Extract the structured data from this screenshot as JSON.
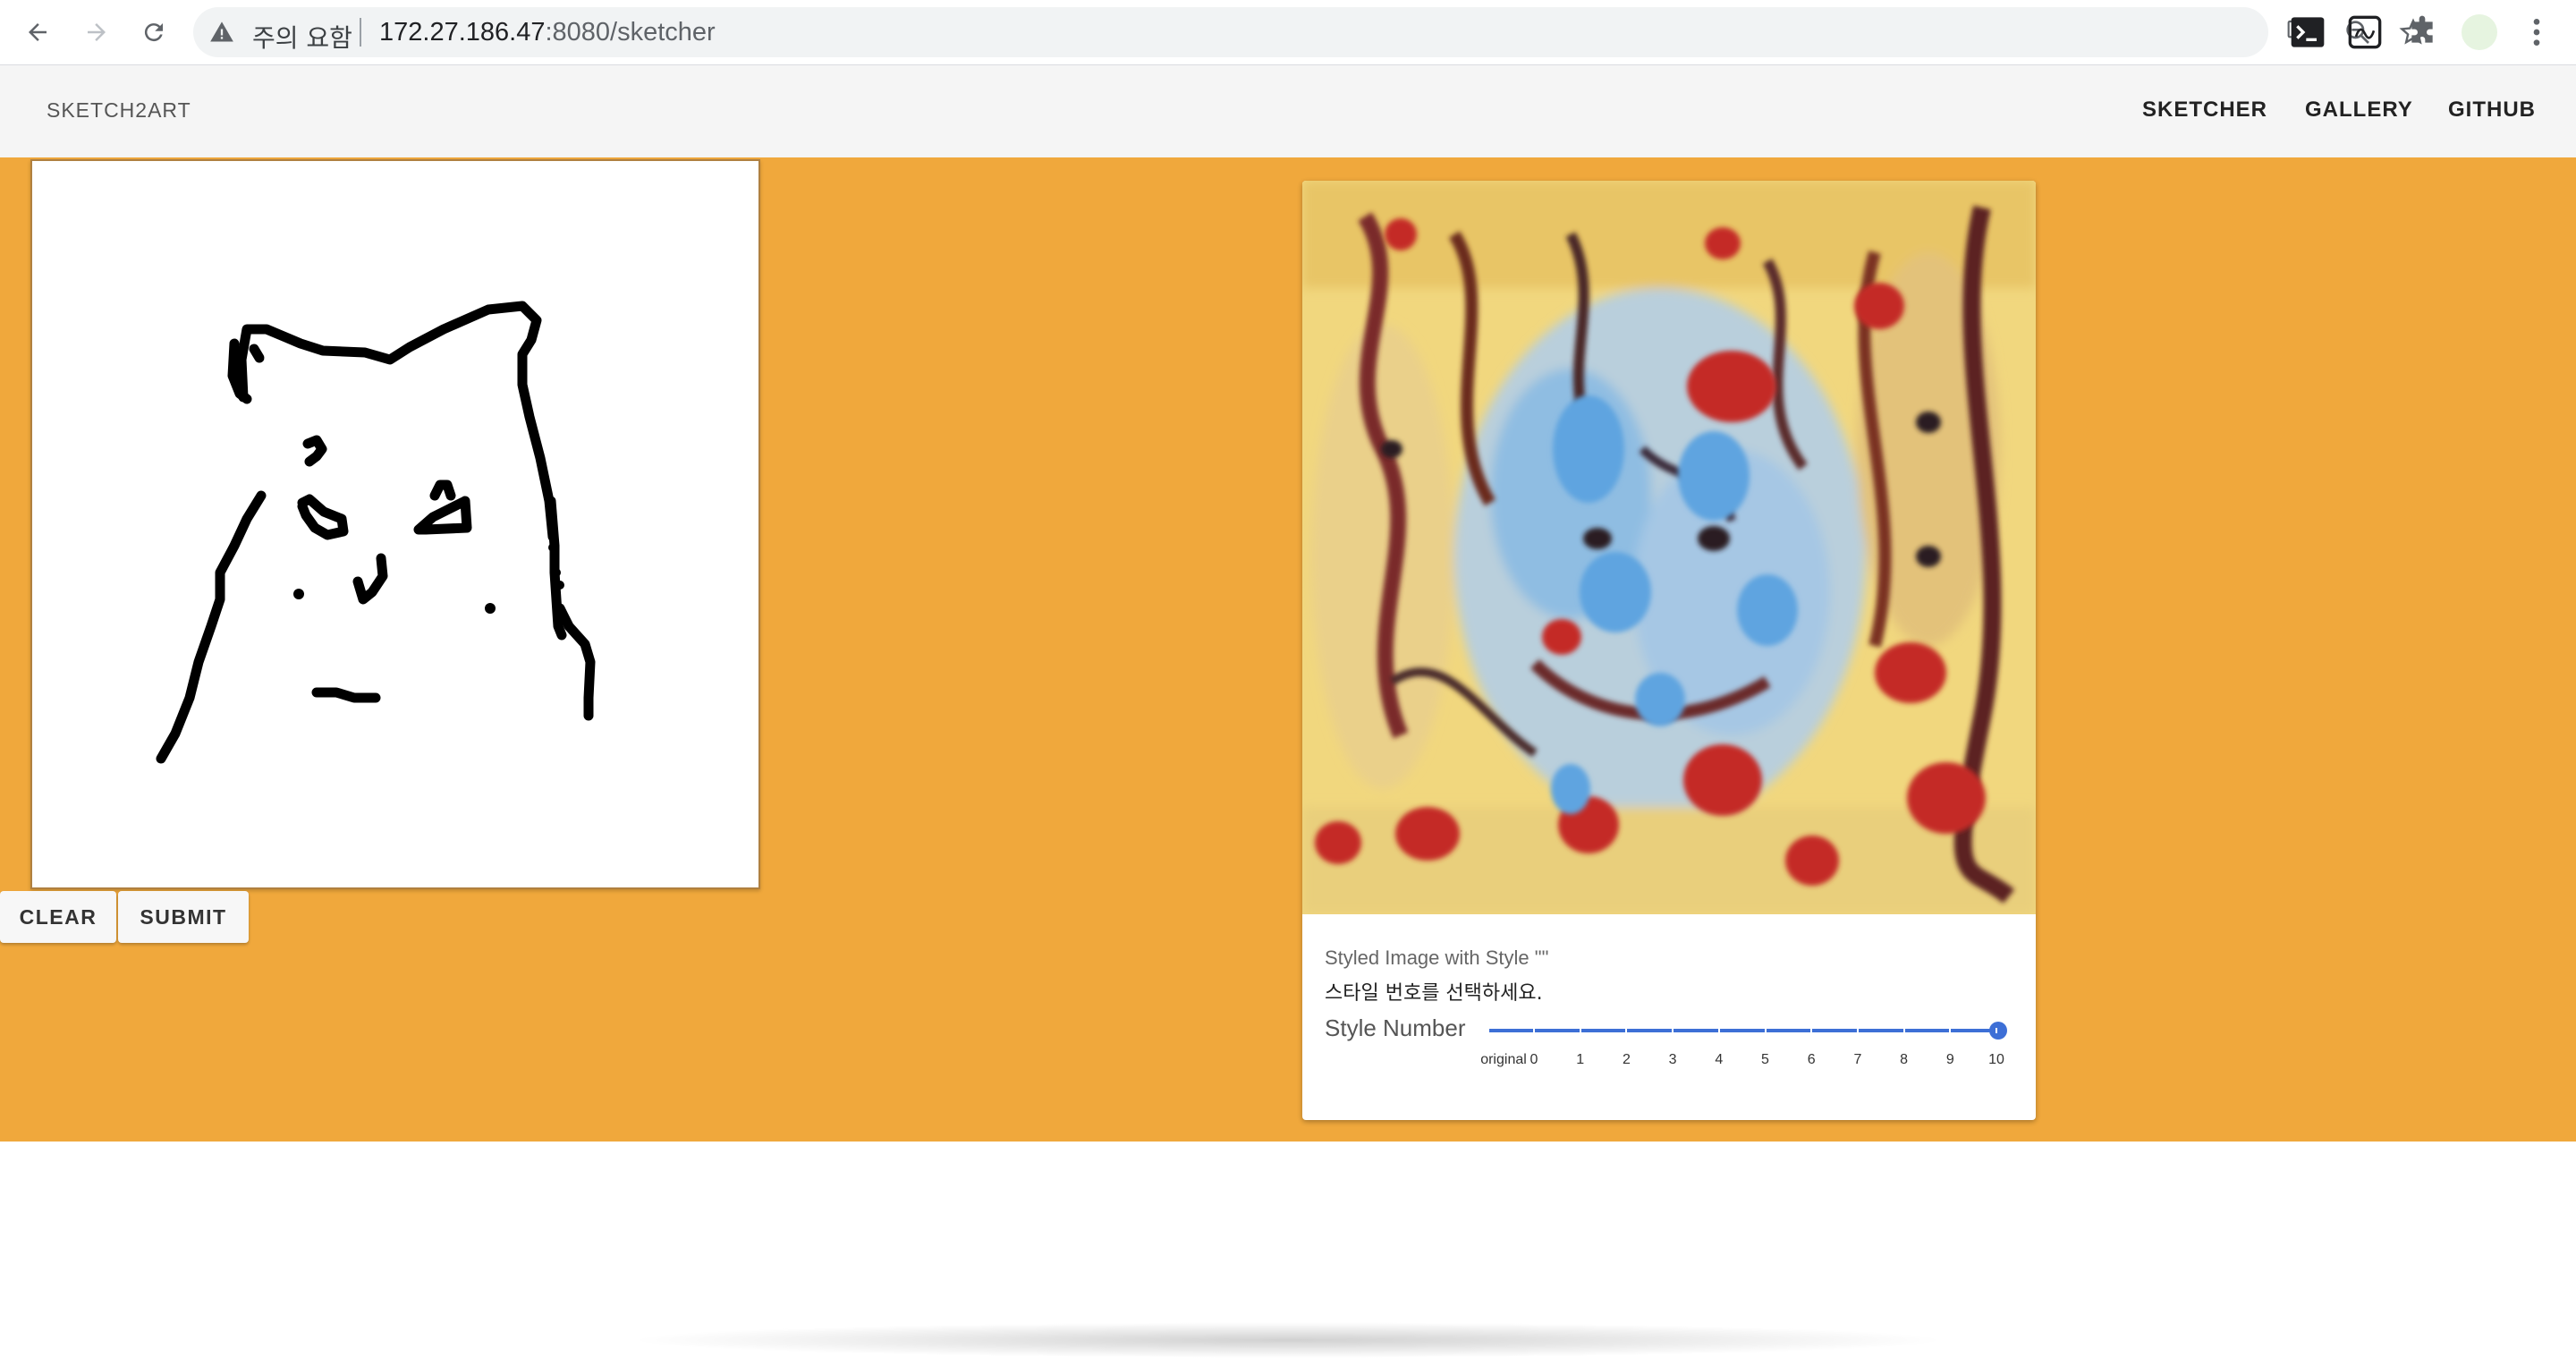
{
  "browser": {
    "security_label": "주의 요함",
    "url_host": "172.27.186.47",
    "url_path": ":8080/sketcher"
  },
  "app": {
    "brand": "SKETCH2ART",
    "nav": [
      {
        "label": "SKETCHER"
      },
      {
        "label": "GALLERY"
      },
      {
        "label": "GITHUB"
      }
    ]
  },
  "sketcher": {
    "clear_label": "CLEAR",
    "submit_label": "SUBMIT"
  },
  "result": {
    "caption": "Styled Image with Style \"\"",
    "hint": "스타일 번호를 선택하세요.",
    "slider_label": "Style Number",
    "slider_value": "10",
    "slider_ticks": [
      "original",
      "0",
      "1",
      "2",
      "3",
      "4",
      "5",
      "6",
      "7",
      "8",
      "9",
      "10"
    ]
  },
  "colors": {
    "accent": "#f0a83c",
    "slider": "#3d6fd6"
  }
}
